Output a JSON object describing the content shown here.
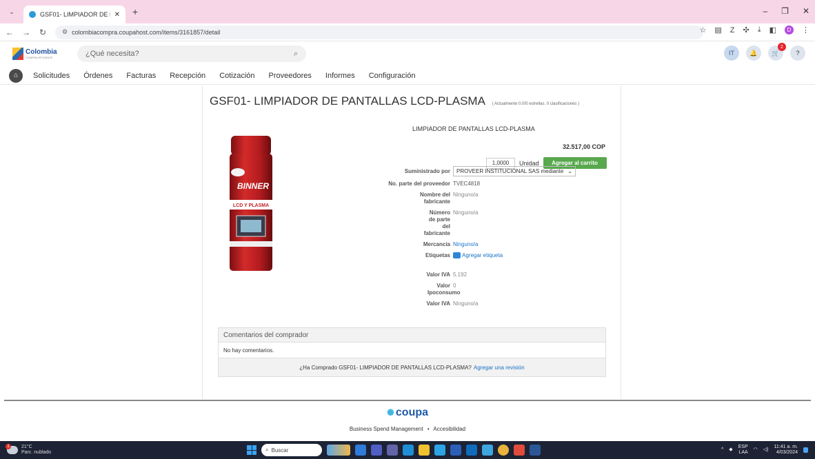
{
  "browser": {
    "tab_title": "GSF01- LIMPIADOR DE PANTAL",
    "url": "colombiacompra.coupahost.com/items/3161857/detail",
    "profile_initial": "D"
  },
  "header": {
    "logo_text": "Colombia",
    "logo_sub": "COMPRA EFICIENTE",
    "search_placeholder": "¿Qué necesita?",
    "user_initials": "IT",
    "cart_count": "2",
    "help": "?"
  },
  "nav": {
    "items": [
      "Solicitudes",
      "Órdenes",
      "Facturas",
      "Recepción",
      "Cotización",
      "Proveedores",
      "Informes",
      "Configuración"
    ]
  },
  "product": {
    "title": "GSF01- LIMPIADOR DE PANTALLAS LCD-PLASMA",
    "rating_text": "( Actualmente 0.0/5 estrellas. 0 clasificaciones )",
    "name": "LIMPIADOR DE PANTALLAS LCD-PLASMA",
    "price": "32.517,00 COP",
    "quantity": "1,0000",
    "unit": "Unidad",
    "add_to_cart": "Agregar al carrito",
    "image_brand": "BINNER",
    "image_band": "LCD Y PLASMA"
  },
  "fields": {
    "supplied_by_label": "Suministrado por",
    "supplied_by_value": "PROVEER INSTITUCIONAL SAS mediante",
    "part_no_label": "No. parte del proveedor",
    "part_no_value": "TVEC4818",
    "mfr_name_label": "Nombre del fabricante",
    "mfr_name_value": "Ninguno/a",
    "mfr_part_label": "Número de parte del fabricante",
    "mfr_part_value": "Ninguno/a",
    "commodity_label": "Mercancía",
    "commodity_value": "Ninguno/a",
    "tags_label": "Etiquetas",
    "tags_value": "Agregar etiqueta",
    "iva_label": "Valor IVA",
    "iva_value": "5.192",
    "ipoconsumo_label": "Valor Ipoconsumo",
    "ipoconsumo_value": "0",
    "iva2_label": "Valor IVA",
    "iva2_value": "Ninguno/a"
  },
  "comments": {
    "header": "Comentarios del comprador",
    "empty": "No hay comentarios.",
    "question": "¿Ha Comprado GSF01- LIMPIADOR DE PANTALLAS LCD-PLASMA?",
    "review_link": "Agregar una revisión"
  },
  "footer": {
    "brand": "coupa",
    "link1": "Business Spend Management",
    "sep": "•",
    "link2": "Accesibilidad"
  },
  "taskbar": {
    "weather_temp": "21°C",
    "weather_desc": "Parc. nublado",
    "weather_badge": "1",
    "search": "Buscar",
    "lang1": "ESP",
    "lang2": "LAA",
    "time": "11:41 a. m.",
    "date": "4/03/2024"
  }
}
